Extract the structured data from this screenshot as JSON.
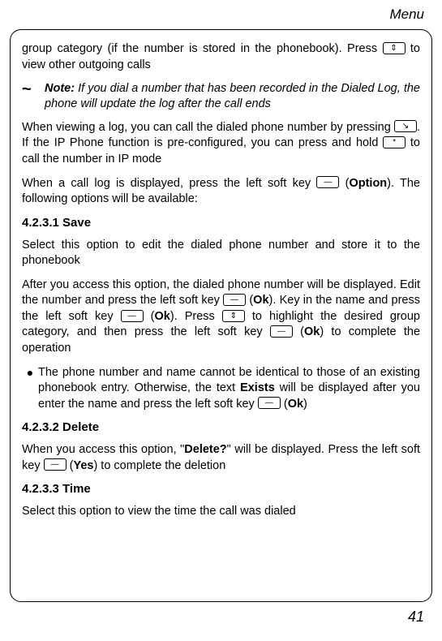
{
  "header": "Menu",
  "page_number": "41",
  "p1_a": "group category (if the number is stored in the phonebook). Press ",
  "p1_b": " to view other outgoing calls",
  "note_label": "Note:",
  "note_body": " If you dial a number that has been recorded in the Dialed Log, the phone will update the log after the call ends",
  "p2_a": "When viewing a log, you can call the dialed phone number by pressing ",
  "p2_b": ". If the IP Phone function is pre-configured, you can press and hold ",
  "p2_c": " to call the number in IP mode",
  "p3_a": "When a call log is displayed, press the left soft key ",
  "p3_b": " (",
  "p3_c": "Option",
  "p3_d": "). The following options will be available:",
  "h_save": "4.2.3.1 Save",
  "p4": "Select this option to edit the dialed phone number and store it to the phonebook",
  "p5_a": "After you access this option, the dialed phone number will be displayed. Edit the number and press the left soft key ",
  "p5_b": " (",
  "p5_c": "Ok",
  "p5_d": "). Key in the name and press the left soft key ",
  "p5_e": " (",
  "p5_f": "Ok",
  "p5_g": "). Press ",
  "p5_h": " to highlight the desired group category, and then press the left soft key ",
  "p5_i": " (",
  "p5_j": "Ok",
  "p5_k": ") to complete the operation",
  "b1_a": "The phone number and name cannot be identical to those of an existing phonebook entry. Otherwise, the text ",
  "b1_b": "Exists",
  "b1_c": " will be displayed after you enter the name and press the left soft key ",
  "b1_d": " (",
  "b1_e": "Ok",
  "b1_f": ")",
  "h_delete": "4.2.3.2 Delete",
  "p6_a": "When you access this option, \"",
  "p6_b": "Delete?",
  "p6_c": "\" will be displayed. Press the left soft key ",
  "p6_d": " (",
  "p6_e": "Yes",
  "p6_f": ") to complete the deletion",
  "h_time": "4.2.3.3 Time",
  "p7": "Select this option to view the time the call was dialed",
  "icons": {
    "updown": "⇕",
    "call": "↘",
    "star": "*",
    "softkey": "—"
  }
}
